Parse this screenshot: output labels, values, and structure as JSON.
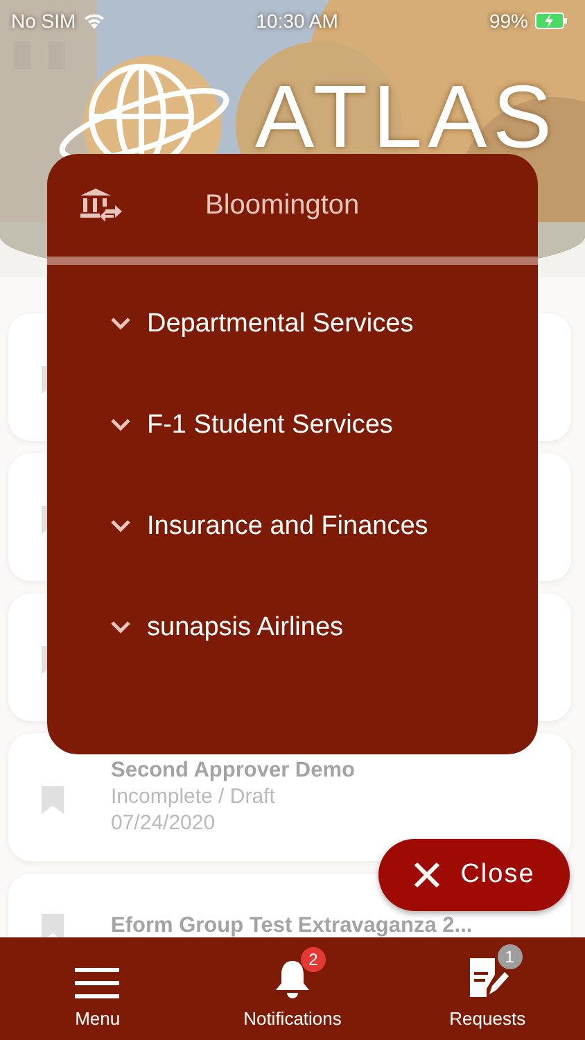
{
  "status_bar": {
    "carrier": "No SIM",
    "time": "10:30 AM",
    "battery": "99%"
  },
  "header": {
    "logo_text": "ATLAS"
  },
  "requests": [
    {
      "kind": "covered"
    },
    {
      "kind": "covered"
    },
    {
      "kind": "covered"
    },
    {
      "kind": "request",
      "title": "Second Approver Demo",
      "status": "Incomplete / Draft",
      "date": "07/24/2020"
    },
    {
      "kind": "request",
      "title": "Eform Group Test Extravaganza 2..."
    }
  ],
  "campus_menu": {
    "campus": "Bloomington",
    "groups": [
      {
        "label": "Departmental Services"
      },
      {
        "label": "F-1 Student Services"
      },
      {
        "label": "Insurance and Finances"
      },
      {
        "label": "sunapsis Airlines"
      }
    ]
  },
  "close_button": {
    "label": "Close"
  },
  "tab_bar": [
    {
      "kind": "menu",
      "label": "Menu"
    },
    {
      "kind": "notifications",
      "label": "Notifications",
      "badge": {
        "text": "2",
        "color": "#e53935"
      }
    },
    {
      "kind": "requests",
      "label": "Requests",
      "badge": {
        "text": "1",
        "color": "#9e9e9e"
      }
    }
  ]
}
